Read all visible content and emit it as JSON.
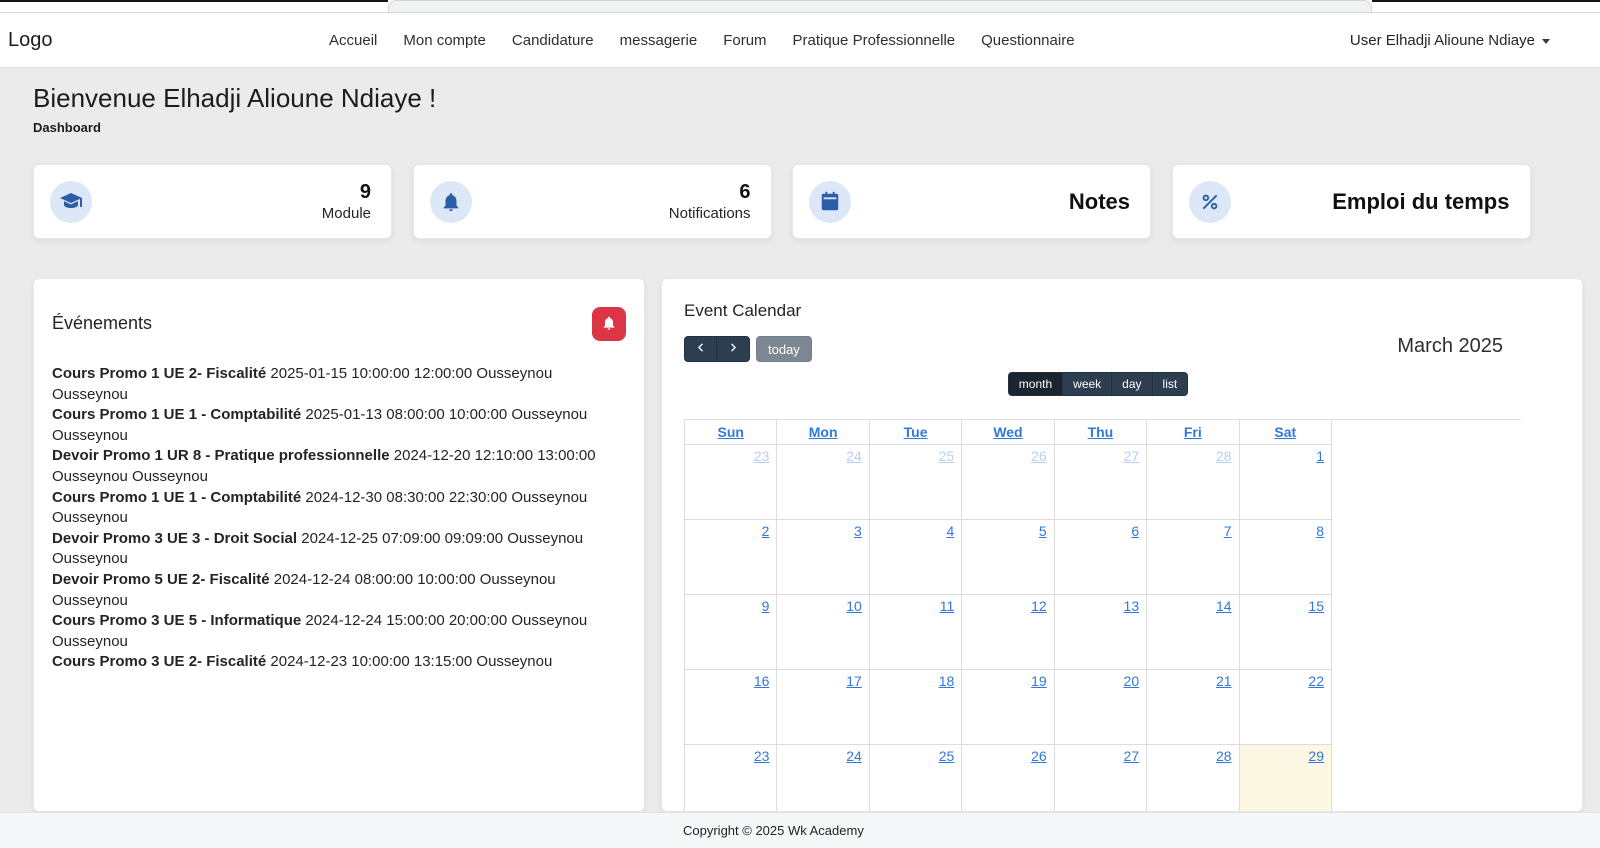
{
  "navbar": {
    "logo": "Logo",
    "links": [
      "Accueil",
      "Mon compte",
      "Candidature",
      "messagerie",
      "Forum",
      "Pratique Professionnelle",
      "Questionnaire"
    ],
    "user_menu": "User Elhadji Alioune Ndiaye"
  },
  "header": {
    "welcome": "Bienvenue Elhadji Alioune Ndiaye !",
    "breadcrumb": "Dashboard"
  },
  "stats": {
    "cards": [
      {
        "name": "module",
        "icon": "graduation-cap",
        "value": "9",
        "label": "Module",
        "clickable": false
      },
      {
        "name": "notifications",
        "icon": "bell",
        "value": "6",
        "label": "Notifications",
        "clickable": false
      },
      {
        "name": "notes",
        "icon": "calendar",
        "title": "Notes",
        "clickable": true
      },
      {
        "name": "emploi-du-temps",
        "icon": "percent",
        "title": "Emploi du temps",
        "clickable": true
      }
    ]
  },
  "events": {
    "title": "Événements",
    "items": [
      {
        "name": "Cours Promo 1 UE 2- Fiscalité",
        "meta": "2025-01-15 10:00:00 12:00:00 Ousseynou Ousseynou"
      },
      {
        "name": "Cours Promo 1 UE 1 - Comptabilité",
        "meta": "2025-01-13 08:00:00 10:00:00 Ousseynou Ousseynou"
      },
      {
        "name": "Devoir Promo 1 UR 8 - Pratique professionnelle",
        "meta": "2024-12-20 12:10:00 13:00:00 Ousseynou Ousseynou"
      },
      {
        "name": "Cours Promo 1 UE 1 - Comptabilité",
        "meta": "2024-12-30 08:30:00 22:30:00 Ousseynou Ousseynou"
      },
      {
        "name": "Devoir Promo 3 UE 3 - Droit Social",
        "meta": "2024-12-25 07:09:00 09:09:00 Ousseynou Ousseynou"
      },
      {
        "name": "Devoir Promo 5 UE 2- Fiscalité",
        "meta": "2024-12-24 08:00:00 10:00:00 Ousseynou Ousseynou"
      },
      {
        "name": "Cours Promo 3 UE 5 - Informatique",
        "meta": "2024-12-24 15:00:00 20:00:00 Ousseynou Ousseynou"
      },
      {
        "name": "Cours Promo 3 UE 2- Fiscalité",
        "meta": "2024-12-23 10:00:00 13:15:00 Ousseynou Ousseynou"
      }
    ]
  },
  "calendar": {
    "title": "Event Calendar",
    "toolbar": {
      "today_label": "today",
      "month_title": "March 2025",
      "views": [
        "month",
        "week",
        "day",
        "list"
      ],
      "active_view": "month"
    },
    "day_headers": [
      "Sun",
      "Mon",
      "Tue",
      "Wed",
      "Thu",
      "Fri",
      "Sat"
    ],
    "weeks": [
      [
        {
          "d": "23",
          "o": 1
        },
        {
          "d": "24",
          "o": 1
        },
        {
          "d": "25",
          "o": 1
        },
        {
          "d": "26",
          "o": 1
        },
        {
          "d": "27",
          "o": 1
        },
        {
          "d": "28",
          "o": 1
        },
        {
          "d": "1"
        }
      ],
      [
        {
          "d": "2"
        },
        {
          "d": "3"
        },
        {
          "d": "4"
        },
        {
          "d": "5"
        },
        {
          "d": "6"
        },
        {
          "d": "7"
        },
        {
          "d": "8"
        }
      ],
      [
        {
          "d": "9"
        },
        {
          "d": "10"
        },
        {
          "d": "11"
        },
        {
          "d": "12"
        },
        {
          "d": "13"
        },
        {
          "d": "14"
        },
        {
          "d": "15"
        }
      ],
      [
        {
          "d": "16"
        },
        {
          "d": "17"
        },
        {
          "d": "18"
        },
        {
          "d": "19"
        },
        {
          "d": "20"
        },
        {
          "d": "21"
        },
        {
          "d": "22"
        }
      ],
      [
        {
          "d": "23"
        },
        {
          "d": "24"
        },
        {
          "d": "25"
        },
        {
          "d": "26"
        },
        {
          "d": "27"
        },
        {
          "d": "28"
        },
        {
          "d": "29",
          "t": 1
        }
      ]
    ]
  },
  "footer": {
    "text": "Copyright © 2025 Wk Academy"
  },
  "colors": {
    "accent_blue": "#2b5ea7",
    "icon_circle_bg": "#dce7f7",
    "danger_red": "#dc3545",
    "link_blue": "#3178dc",
    "fc_button_dark": "#2c3e50",
    "fc_button_active": "#1a252f",
    "today_cell_bg": "#fcf8e3",
    "page_bg": "#ebebeb"
  }
}
